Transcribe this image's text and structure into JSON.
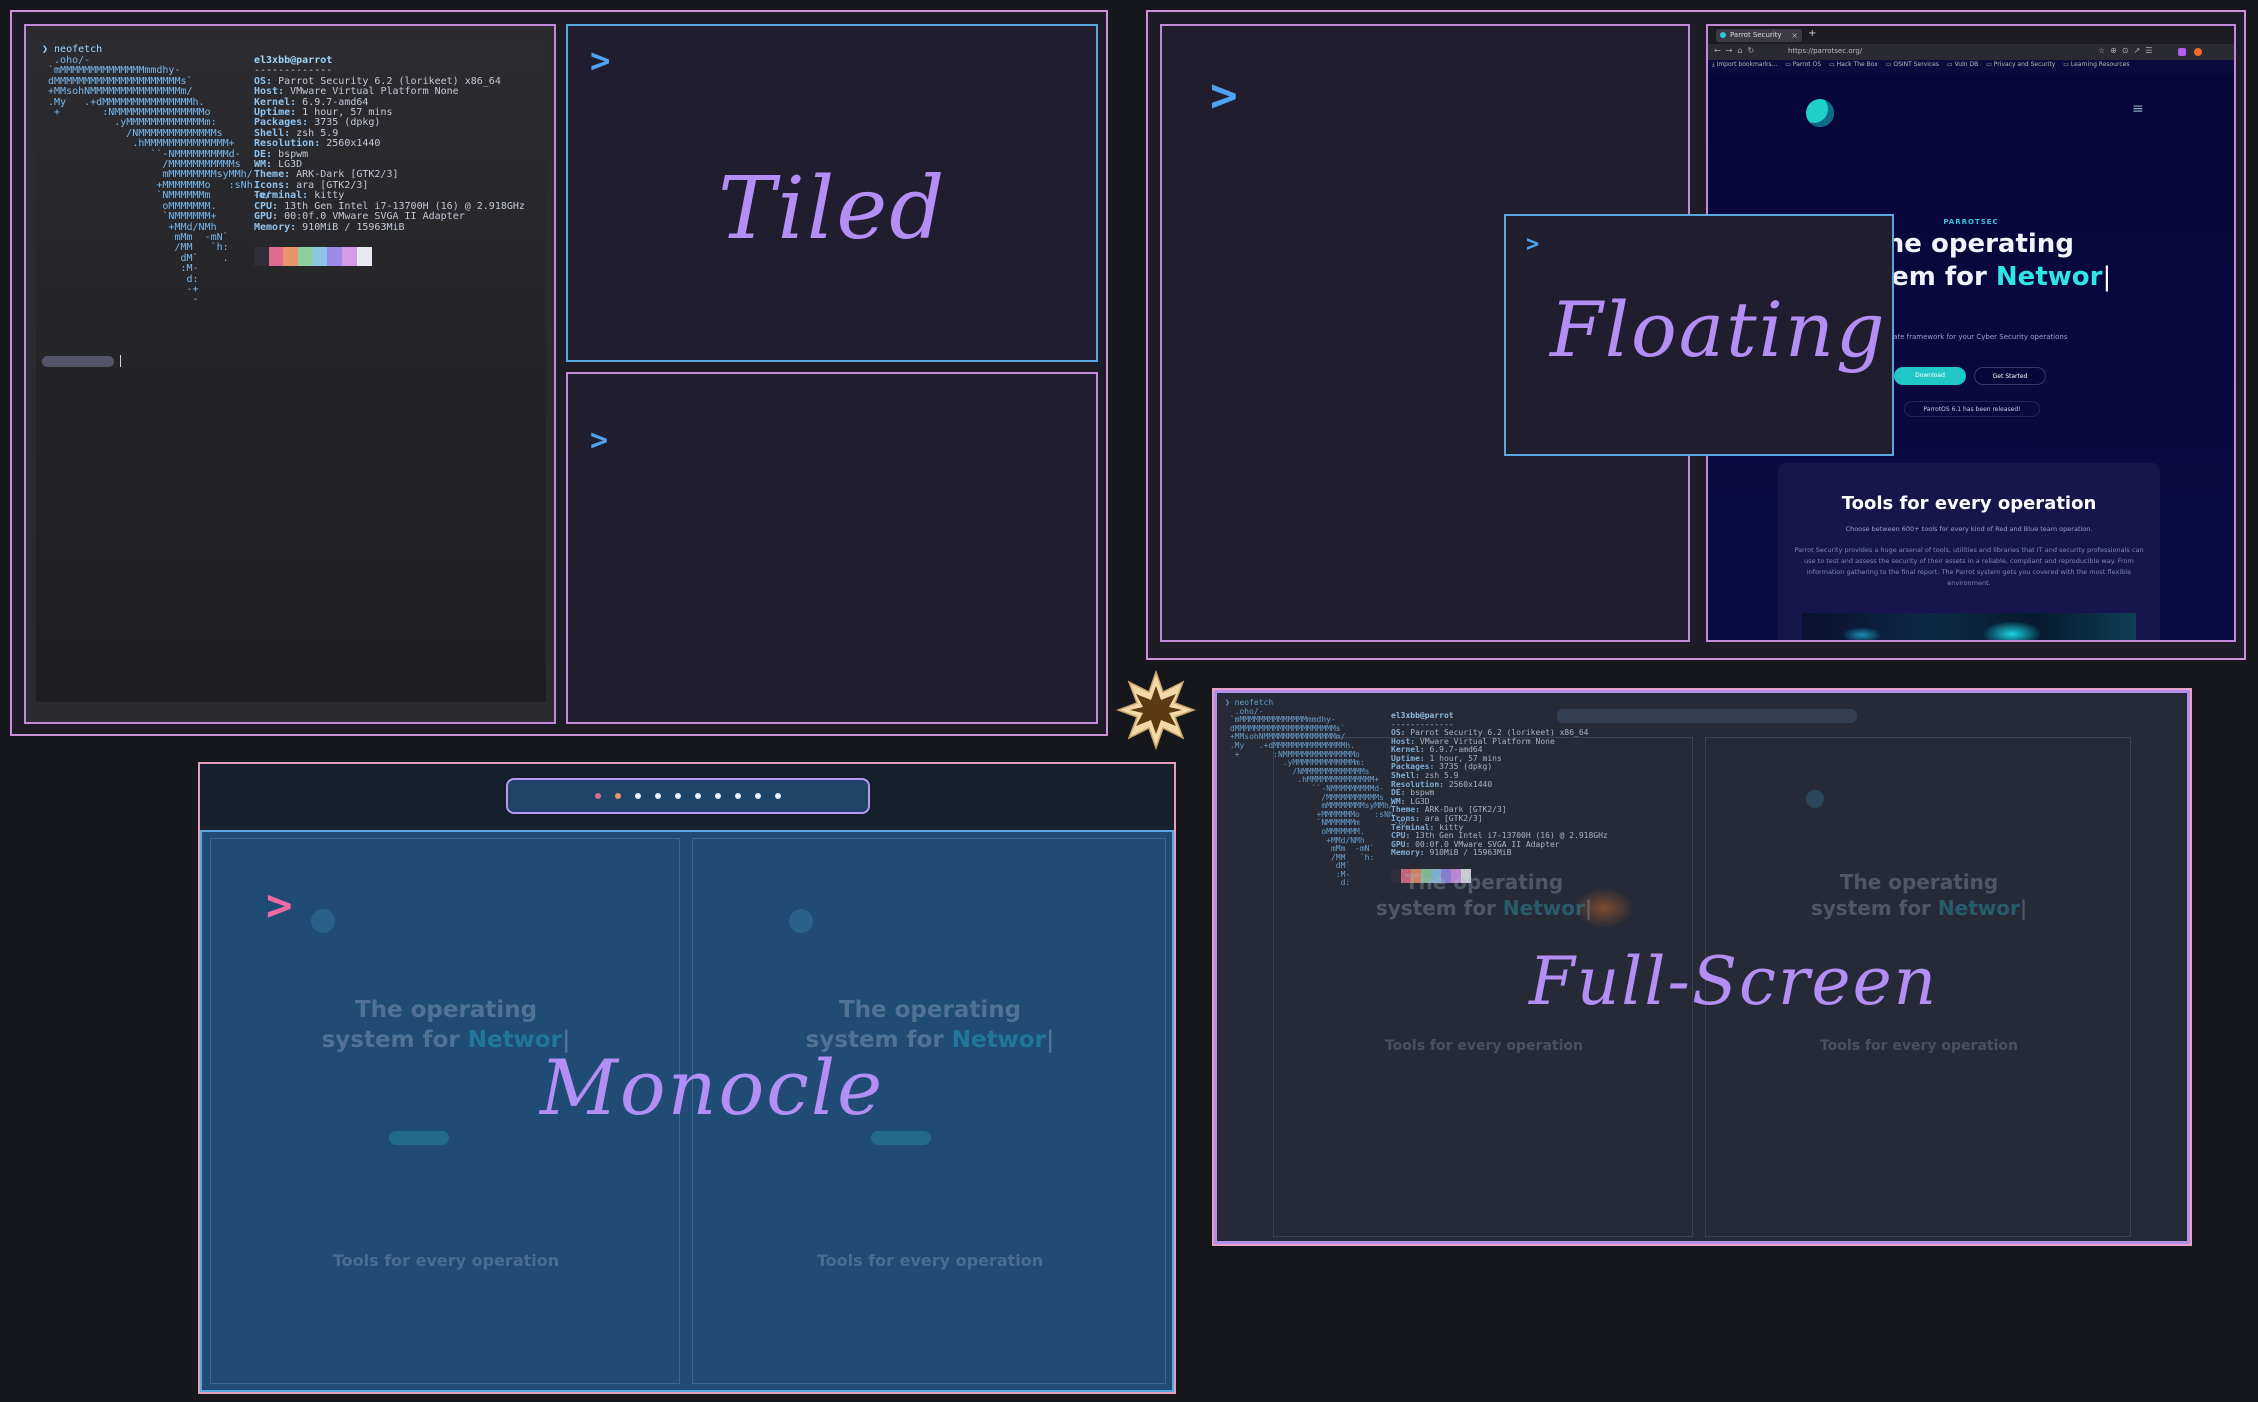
{
  "tiled": {
    "label": "Tiled",
    "terminal": {
      "command": "❯ neofetch",
      "user_host": "el3xbb@parrot",
      "separator": "-------------",
      "info": [
        {
          "key": "OS:",
          "value": "Parrot Security 6.2 (lorikeet) x86_64"
        },
        {
          "key": "Host:",
          "value": "VMware Virtual Platform None"
        },
        {
          "key": "Kernel:",
          "value": "6.9.7-amd64"
        },
        {
          "key": "Uptime:",
          "value": "1 hour, 57 mins"
        },
        {
          "key": "Packages:",
          "value": "3735 (dpkg)"
        },
        {
          "key": "Shell:",
          "value": "zsh 5.9"
        },
        {
          "key": "Resolution:",
          "value": "2560x1440"
        },
        {
          "key": "DE:",
          "value": "bspwm"
        },
        {
          "key": "WM:",
          "value": "LG3D"
        },
        {
          "key": "Theme:",
          "value": "ARK-Dark [GTK2/3]"
        },
        {
          "key": "Icons:",
          "value": "ara [GTK2/3]"
        },
        {
          "key": "Terminal:",
          "value": "kitty"
        },
        {
          "key": "CPU:",
          "value": "13th Gen Intel i7-13700H (16) @ 2.918GHz"
        },
        {
          "key": "GPU:",
          "value": "00:0f.0 VMware SVGA II Adapter"
        },
        {
          "key": "Memory:",
          "value": "910MiB / 15963MiB"
        }
      ],
      "palette": [
        "#2f2f3a",
        "#e06c8c",
        "#e8946c",
        "#8fd0a0",
        "#8cc6e8",
        "#9a8ce8",
        "#d49ae8",
        "#e8e8f0"
      ]
    },
    "prompt_glyph": ">"
  },
  "floating": {
    "label": "Floating",
    "prompt_glyph": ">",
    "browser": {
      "tab_title": "Parrot Security",
      "url": "https://parrotsec.org/",
      "bookmarks": [
        "Import bookmarks...",
        "Parrot OS",
        "Hack The Box",
        "OSINT Services",
        "Vuln DB",
        "Privacy and Security",
        "Learning Resources"
      ],
      "eyebrow": "PARROTSEC",
      "hero_line1": "The operating",
      "hero_line2_prefix": "system for ",
      "hero_line2_accent": "Networ",
      "tagline": "Ultimate framework for your Cyber Security operations",
      "download_btn": "Download",
      "started_btn": "Get Started",
      "release_note": "ParrotOS 6.1 has been released!",
      "tools_title": "Tools for every operation",
      "tools_sub": "Choose between 600+ tools for every kind of Red and Blue team operation.",
      "tools_body": "Parrot Security provides a huge arsenal of tools, utilities and libraries that IT and security professionals can use to test and assess the security of their assets in a reliable, compliant and reproducible way. From information gathering to the final report. The Parrot system gets you covered with the most flexible environment."
    }
  },
  "monocle": {
    "label": "Monocle",
    "prompt_glyph": ">",
    "workspace_dots": 10,
    "ghost_hero_line1": "The operating",
    "ghost_hero_prefix": "system for ",
    "ghost_hero_accent": "Networ",
    "ghost_tools": "Tools for every operation"
  },
  "fullscreen": {
    "label": "Full-Screen",
    "ghost_hero_line1": "The operating",
    "ghost_hero_prefix": "system for ",
    "ghost_hero_accent": "Networ",
    "ghost_tools": "Tools for every operation"
  },
  "colors": {
    "frame_pink": "#c08ad8",
    "frame_blue": "#5aa7e0",
    "label_purple": "#b28ef5",
    "prompt_blue": "#4fa3f0",
    "prompt_pink": "#f06aa0",
    "accent_cyan": "#2ee6e6"
  }
}
